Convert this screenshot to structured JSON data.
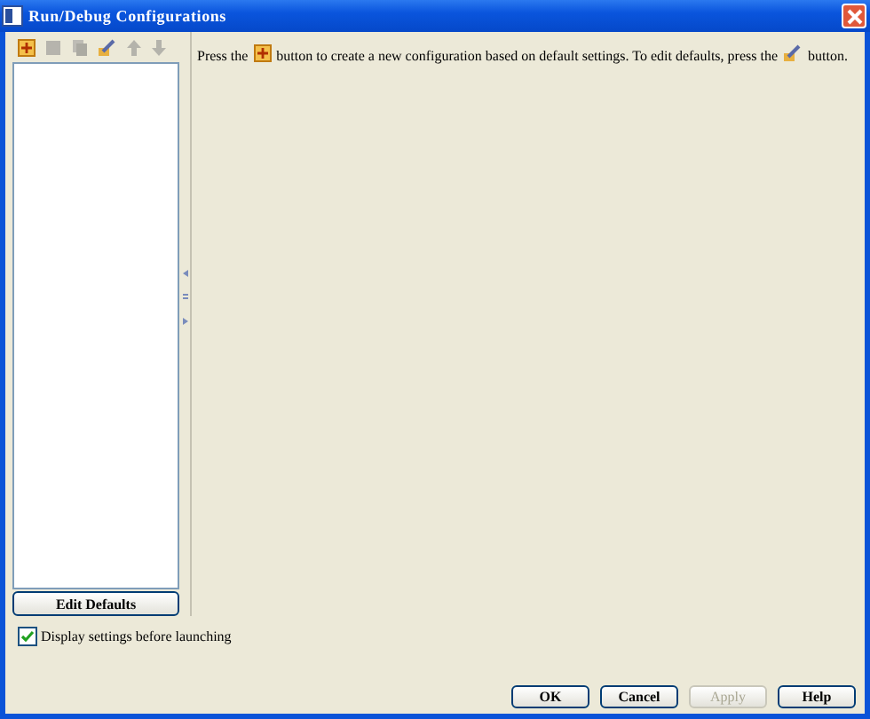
{
  "window": {
    "title": "Run/Debug Configurations"
  },
  "toolbar": [
    {
      "kind": "add",
      "disabled": false
    },
    {
      "kind": "remove",
      "disabled": true
    },
    {
      "kind": "copy",
      "disabled": true
    },
    {
      "kind": "edit",
      "disabled": false
    },
    {
      "kind": "up",
      "disabled": true
    },
    {
      "kind": "down",
      "disabled": true
    }
  ],
  "message": [
    {
      "kind": "text",
      "text": "Press the"
    },
    {
      "kind": "add-icon"
    },
    {
      "kind": "text",
      "text": "button to create a new configuration based on default settings.  To edit defaults, press the"
    },
    {
      "kind": "edit-icon"
    },
    {
      "kind": "text",
      "text": "button."
    }
  ],
  "edit_defaults_button": "Edit Defaults",
  "display_settings": {
    "label": "Display settings before launching",
    "checked": true
  },
  "buttons": [
    {
      "label": "OK",
      "disabled": false
    },
    {
      "label": "Cancel",
      "disabled": false
    },
    {
      "label": "Apply",
      "disabled": true
    },
    {
      "label": "Help",
      "disabled": false
    }
  ]
}
